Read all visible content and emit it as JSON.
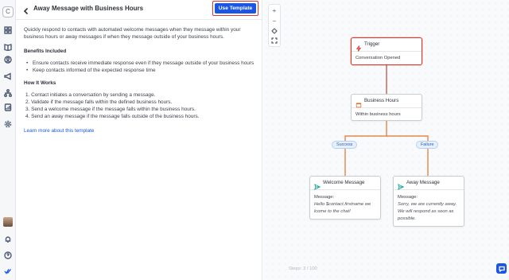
{
  "rail": {
    "logo_letter": "C",
    "icons": [
      "grid-icon",
      "book-icon",
      "inbox-icon",
      "contact-icon",
      "megaphone-icon",
      "workflow-icon",
      "report-icon",
      "settings-icon"
    ],
    "bottom_icons": [
      "avatar",
      "bell-icon",
      "help-icon",
      "check-icon"
    ]
  },
  "header": {
    "title": "Away Message with Business Hours",
    "use_template_label": "Use Template"
  },
  "content": {
    "description": "Quickly respond to contacts with automated welcome messages when they message within your business hours or away messages if when they message outside of your business hours.",
    "benefits_heading": "Benefits Included",
    "benefits": [
      "Ensure contacts receive immediate response even if they message outside of your business hours",
      "Keep contacts informed of the expected response time"
    ],
    "how_heading": "How It Works",
    "steps": [
      "1. Contact initiates a conversation by sending a message.",
      "2. Validate if the message falls within the defined business hours.",
      "3. Send a welcome message if the message falls within the business hours.",
      "4. Send an away message if the message falls outside of the business hours."
    ],
    "learn_more": "Learn more about this template"
  },
  "zoom": {
    "plus": "+",
    "minus": "−"
  },
  "flow": {
    "trigger": {
      "title": "Trigger",
      "body": "Conversation Opened"
    },
    "business_hours": {
      "title": "Business Hours",
      "body": "Within business hours"
    },
    "success_label": "Success",
    "failure_label": "Failure",
    "welcome": {
      "title": "Welcome Message",
      "body_label": "Message:",
      "message": "Hello $contact.firstname we lcome to the chat!"
    },
    "away": {
      "title": "Away Message",
      "body_label": "Message:",
      "message": "Sorry, we are currently away. We will respond as soon as possible."
    }
  },
  "steps_counter": "Steps: 3 / 100",
  "colors": {
    "primary": "#1b56e3",
    "trigger_accent": "#d9362c",
    "hours_accent": "#e0732a",
    "message_accent": "#1aa39b",
    "connector": "#b9463e",
    "branch": "#e0732a"
  }
}
